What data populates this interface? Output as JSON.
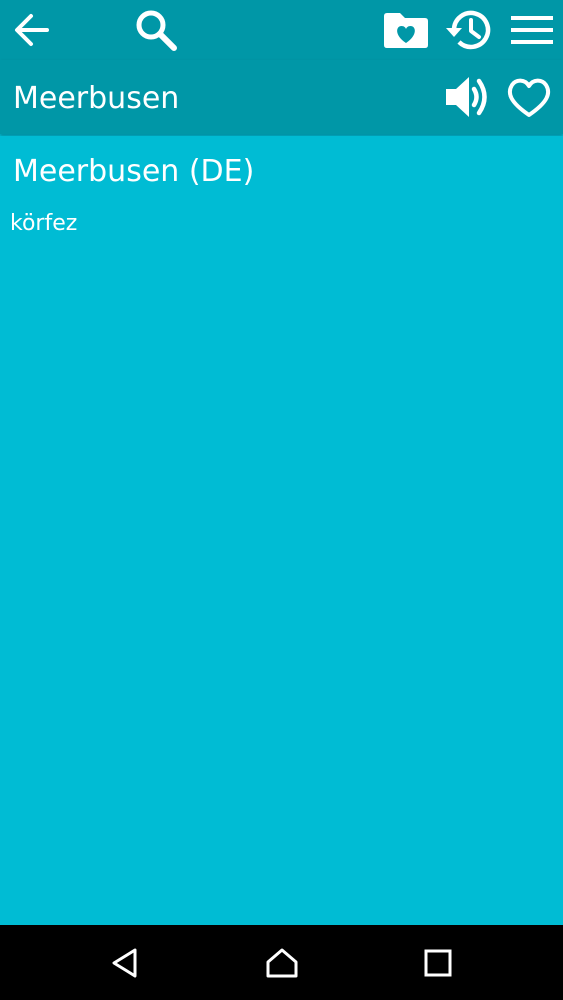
{
  "toolbar": {
    "icons": {
      "back": "arrow-back-icon",
      "search": "search-icon",
      "favorites_folder": "folder-heart-icon",
      "history": "history-icon",
      "menu": "hamburger-menu-icon"
    }
  },
  "entry_header": {
    "title": "Meerbusen",
    "icons": {
      "speak": "speaker-icon",
      "favorite": "heart-outline-icon"
    }
  },
  "entry": {
    "headword": "Meerbusen (DE)",
    "translation": "körfez"
  },
  "nav": {
    "icons": {
      "back": "nav-back-icon",
      "home": "nav-home-icon",
      "recents": "nav-recents-icon"
    }
  },
  "colors": {
    "toolbar": "#0097a7",
    "content": "#00bcd4",
    "navbar": "#000000",
    "text": "#ffffff"
  }
}
